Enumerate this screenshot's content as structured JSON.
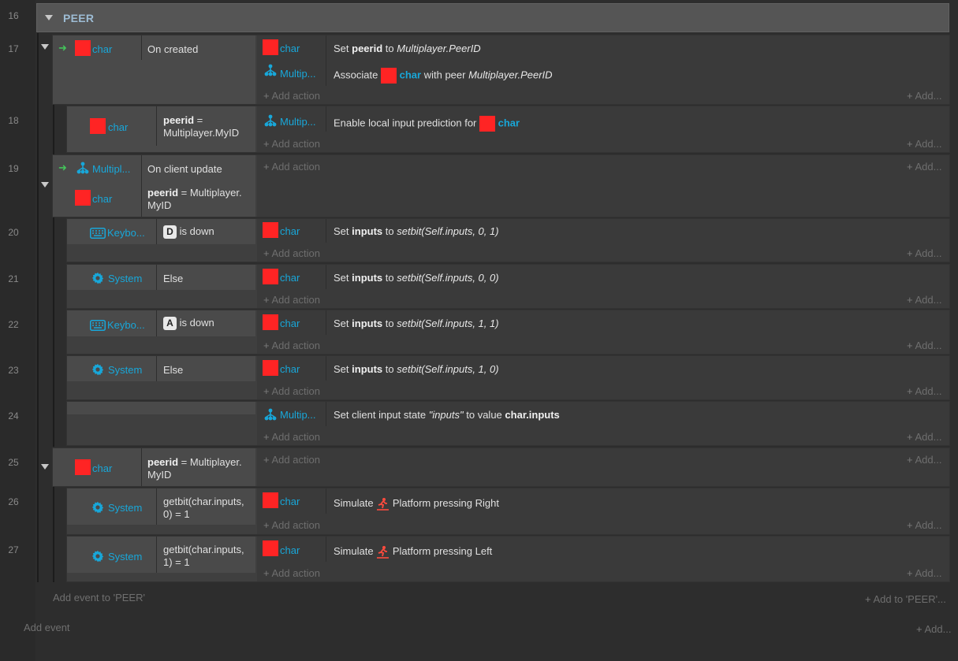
{
  "group": {
    "number": "16",
    "title": "PEER"
  },
  "events": [
    {
      "line": "17",
      "cond": [
        {
          "object": "char",
          "text": "On created"
        }
      ],
      "actions": [
        {
          "object": "char",
          "pre": "Set",
          "strong": "peerid",
          "mid": "to",
          "em": "Multiplayer.PeerID"
        },
        {
          "object": "Multip...",
          "pre": "Associate",
          "obj2": "char",
          "mid": "with peer",
          "em": "Multiplayer.PeerID"
        }
      ]
    },
    {
      "line": "18",
      "cond": [
        {
          "object": "char",
          "strong": "peerid",
          "text": "=",
          "text2": "Multiplayer.MyID"
        }
      ],
      "actions": [
        {
          "object": "Multip...",
          "pre": "Enable local input prediction for",
          "obj2": "char"
        }
      ]
    },
    {
      "line": "19",
      "cond": [
        {
          "object": "Multipl...",
          "text": "On client update"
        },
        {
          "object": "char",
          "strong": "peerid",
          "text": "= Multiplayer.",
          "text2": "MyID"
        }
      ]
    },
    {
      "line": "20",
      "cond": [
        {
          "object": "Keybo...",
          "key": "D",
          "text": "is down"
        }
      ],
      "actions": [
        {
          "object": "char",
          "pre": "Set",
          "strong": "inputs",
          "mid": "to",
          "em": "setbit(Self.inputs, 0, 1)"
        }
      ]
    },
    {
      "line": "21",
      "cond": [
        {
          "object": "System",
          "text": "Else"
        }
      ],
      "actions": [
        {
          "object": "char",
          "pre": "Set",
          "strong": "inputs",
          "mid": "to",
          "em": "setbit(Self.inputs, 0, 0)"
        }
      ]
    },
    {
      "line": "22",
      "cond": [
        {
          "object": "Keybo...",
          "key": "A",
          "text": "is down"
        }
      ],
      "actions": [
        {
          "object": "char",
          "pre": "Set",
          "strong": "inputs",
          "mid": "to",
          "em": "setbit(Self.inputs, 1, 1)"
        }
      ]
    },
    {
      "line": "23",
      "cond": [
        {
          "object": "System",
          "text": "Else"
        }
      ],
      "actions": [
        {
          "object": "char",
          "pre": "Set",
          "strong": "inputs",
          "mid": "to",
          "em": "setbit(Self.inputs, 1, 0)"
        }
      ]
    },
    {
      "line": "24",
      "actions": [
        {
          "object": "Multip...",
          "pre": "Set client input state",
          "em": "\"inputs\"",
          "mid": "to value",
          "strong": "char.inputs"
        }
      ]
    },
    {
      "line": "25",
      "cond": [
        {
          "object": "char",
          "strong": "peerid",
          "text": "= Multiplayer.",
          "text2": "MyID"
        }
      ]
    },
    {
      "line": "26",
      "cond": [
        {
          "object": "System",
          "text": "getbit(char.inputs,",
          "text2": "0) = 1"
        }
      ],
      "actions": [
        {
          "object": "char",
          "pre": "Simulate",
          "icon_label": "Platform",
          "post": "pressing Right"
        }
      ]
    },
    {
      "line": "27",
      "cond": [
        {
          "object": "System",
          "text": "getbit(char.inputs,",
          "text2": "1) = 1"
        }
      ],
      "actions": [
        {
          "object": "char",
          "pre": "Simulate",
          "icon_label": "Platform",
          "post": "pressing Left"
        }
      ]
    }
  ],
  "labels": {
    "add_action": "Add action",
    "add_right": "Add...",
    "add_event_to_group": "Add event to 'PEER'",
    "add_to_group": "Add to 'PEER'...",
    "add_event": "Add event",
    "add_bottom": "Add..."
  },
  "colors": {
    "object_text": "#18a7d9",
    "sprite_icon": "#ff2424",
    "trigger_arrow": "#44c35a"
  }
}
